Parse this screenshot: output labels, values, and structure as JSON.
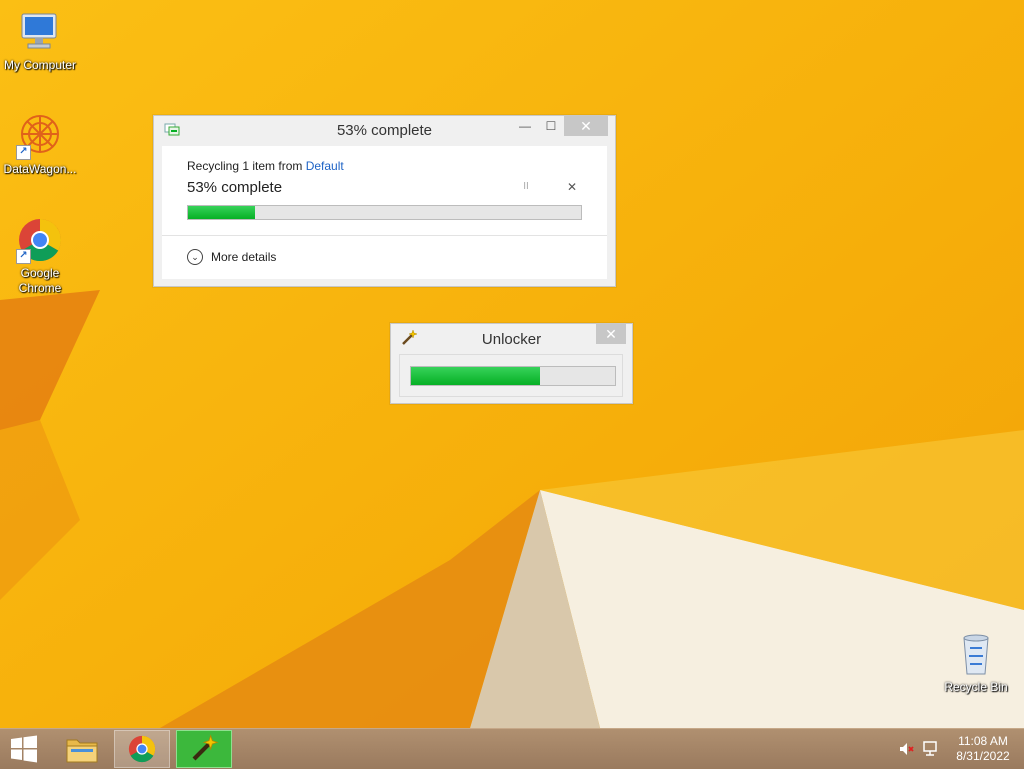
{
  "desktop": {
    "icons": [
      {
        "label": "My Computer"
      },
      {
        "label": "DataWagon..."
      },
      {
        "label": "Google Chrome"
      },
      {
        "label": "Recycle Bin"
      }
    ]
  },
  "copy_dialog": {
    "title": "53% complete",
    "status_prefix": "Recycling 1 item from ",
    "source_link": "Default",
    "progress_text": "53% complete",
    "progress_fraction": 0.17,
    "more_details_label": "More details",
    "pause_glyph": "II",
    "cancel_glyph": "✕",
    "minimize_glyph": "—",
    "maximize_glyph": "☐",
    "close_glyph": "✕"
  },
  "unlocker_dialog": {
    "title": "Unlocker",
    "progress_fraction": 0.63,
    "close_glyph": "✕"
  },
  "taskbar": {
    "items": [
      {
        "name": "start",
        "icon": "windows-logo-icon"
      },
      {
        "name": "file-explorer",
        "icon": "folder-icon"
      },
      {
        "name": "google-chrome",
        "icon": "chrome-icon"
      },
      {
        "name": "unlocker",
        "icon": "magic-wand-icon"
      }
    ],
    "time": "11:08 AM",
    "date": "8/31/2022"
  },
  "colors": {
    "wallpaper_primary": "#f7b30a",
    "progress_green": "#06b025",
    "link_blue": "#1e63c5",
    "taskbar_active": "#3cb83c"
  }
}
